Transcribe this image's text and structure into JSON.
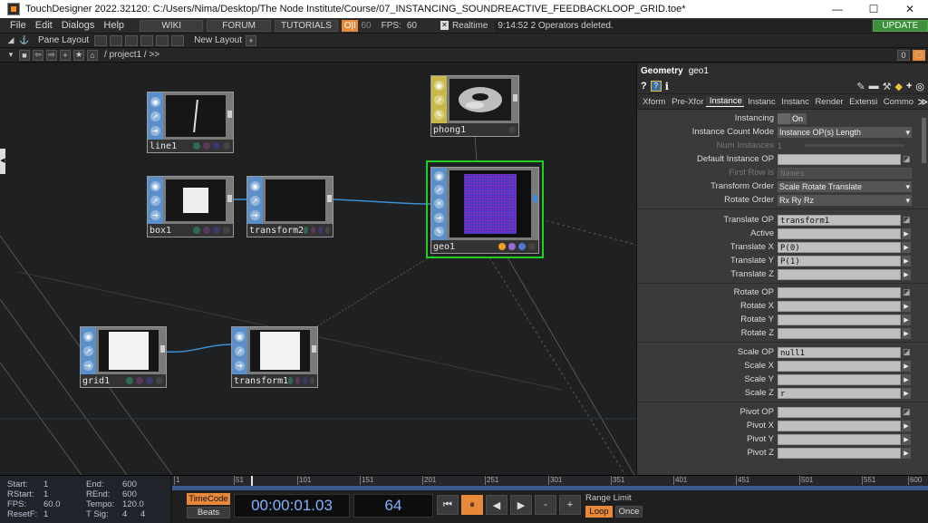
{
  "window": {
    "title": "TouchDesigner 2022.32120: C:/Users/Nima/Desktop/The Node Institute/Course/07_INSTANCING_SOUNDREACTIVE_FEEDBACKLOOP_GRID.toe*",
    "minimize": "—",
    "maximize": "☐",
    "close": "✕"
  },
  "menu": {
    "items": [
      "File",
      "Edit",
      "Dialogs",
      "Help"
    ],
    "wiki": "WIKI",
    "forum": "FORUM",
    "tutorials": "TUTORIALS",
    "oi": "O|I",
    "fps_value": "60",
    "fps_label": "FPS:",
    "fps_value2": "60",
    "realtime": "Realtime",
    "status": "9:14:52 2 Operators deleted.",
    "update": "UPDATE"
  },
  "panebar": {
    "pane_layout": "Pane Layout",
    "new_layout": "New Layout",
    "add": "+"
  },
  "pathbar": {
    "path": "/ project1 / >>",
    "index": "0"
  },
  "nodes": {
    "line1": "line1",
    "box1": "box1",
    "transform2": "transform2",
    "phong1": "phong1",
    "geo1": "geo1",
    "grid1": "grid1",
    "transform1": "transform1"
  },
  "params": {
    "op_type": "Geometry",
    "op_name": "geo1",
    "tabs": [
      "Xform",
      "Pre-Xfor",
      "Instance",
      "Instanc",
      "Instanc",
      "Render",
      "Extensi",
      "Commo"
    ],
    "more": "≫",
    "rows": {
      "instancing": {
        "label": "Instancing",
        "value": "On"
      },
      "count_mode": {
        "label": "Instance Count Mode",
        "value": "Instance OP(s) Length"
      },
      "num_instances": {
        "label": "Num Instances",
        "value": "1"
      },
      "default_op": {
        "label": "Default Instance OP",
        "value": ""
      },
      "first_row": {
        "label": "First Row is",
        "value": "Names"
      },
      "transform_order": {
        "label": "Transform Order",
        "value": "Scale Rotate Translate"
      },
      "rotate_order": {
        "label": "Rotate Order",
        "value": "Rx Ry Rz"
      },
      "translate_op": {
        "label": "Translate OP",
        "value": "transform1"
      },
      "active": {
        "label": "Active",
        "value": ""
      },
      "translate_x": {
        "label": "Translate X",
        "value": "P(0)"
      },
      "translate_y": {
        "label": "Translate Y",
        "value": "P(1)"
      },
      "translate_z": {
        "label": "Translate Z",
        "value": ""
      },
      "rotate_op": {
        "label": "Rotate OP",
        "value": ""
      },
      "rotate_x": {
        "label": "Rotate X",
        "value": ""
      },
      "rotate_y": {
        "label": "Rotate Y",
        "value": ""
      },
      "rotate_z": {
        "label": "Rotate Z",
        "value": ""
      },
      "scale_op": {
        "label": "Scale OP",
        "value": "null1"
      },
      "scale_x": {
        "label": "Scale X",
        "value": ""
      },
      "scale_y": {
        "label": "Scale Y",
        "value": ""
      },
      "scale_z": {
        "label": "Scale Z",
        "value": "r"
      },
      "pivot_op": {
        "label": "Pivot OP",
        "value": ""
      },
      "pivot_x": {
        "label": "Pivot X",
        "value": ""
      },
      "pivot_y": {
        "label": "Pivot Y",
        "value": ""
      },
      "pivot_z": {
        "label": "Pivot Z",
        "value": ""
      }
    }
  },
  "timeline": {
    "start_label": "Start:",
    "start": "1",
    "end_label": "End:",
    "end": "600",
    "rstart_label": "RStart:",
    "rstart": "1",
    "rend_label": "REnd:",
    "rend": "600",
    "fps_label": "FPS:",
    "fps": "60.0",
    "tempo_label": "Tempo:",
    "tempo": "120.0",
    "resetf_label": "ResetF:",
    "resetf": "1",
    "tsig_label": "T Sig:",
    "tsig_a": "4",
    "tsig_b": "4",
    "ruler": [
      "1",
      "51",
      "101",
      "151",
      "201",
      "251",
      "301",
      "351",
      "401",
      "451",
      "501",
      "551",
      "600"
    ],
    "timecode_label": "TimeCode",
    "beats_label": "Beats",
    "timecode": "00:00:01.03",
    "frame": "64",
    "range_limit": "Range Limit",
    "loop": "Loop",
    "once": "Once",
    "btn_start": "⏮",
    "btn_pause": "⏸",
    "btn_back": "◀",
    "btn_fwd": "▶",
    "btn_minus": "-",
    "btn_plus": "+"
  },
  "colors": {
    "accent_orange": "#e8893a",
    "select_green": "#22d022",
    "wire_blue": "#3a8fd6",
    "comp_blue": "#5b8fc9",
    "mat_yellow": "#c9b84a"
  }
}
